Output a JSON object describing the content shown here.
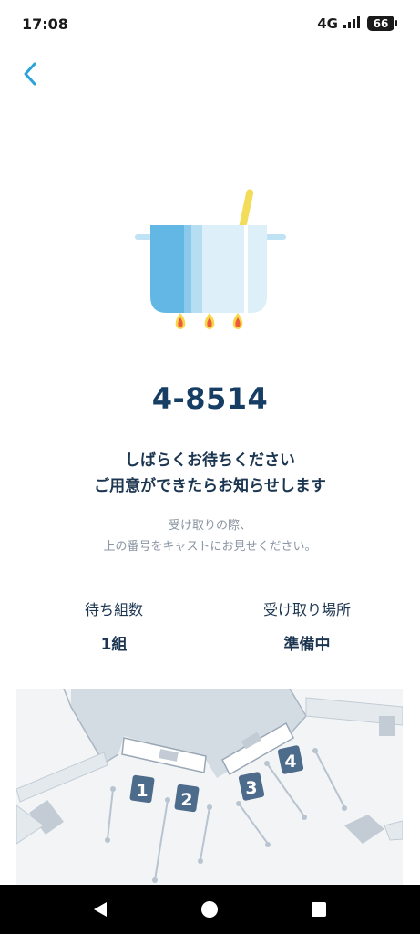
{
  "status_bar": {
    "time": "17:08",
    "network": "4G",
    "battery": "66"
  },
  "icons": {
    "back": "chevron-left-icon",
    "illustration": "cooking-pot-icon",
    "nav_back": "triangle-back-icon",
    "nav_home": "circle-home-icon",
    "nav_recents": "square-recents-icon"
  },
  "order": {
    "number": "4-8514",
    "message_line1": "しばらくお待ちください",
    "message_line2": "ご用意ができたらお知らせします",
    "note_line1": "受け取りの際、",
    "note_line2": "上の番号をキャストにお見せください。"
  },
  "info": {
    "waiting_label": "待ち組数",
    "waiting_value": "1組",
    "pickup_label": "受け取り場所",
    "pickup_value": "準備中"
  },
  "map": {
    "counters": [
      "1",
      "2",
      "3",
      "4"
    ]
  },
  "colors": {
    "accent": "#2aa3d8",
    "primary_text": "#163d63",
    "map_badge": "#4d6b8b",
    "flame": "#ef5a3c"
  }
}
